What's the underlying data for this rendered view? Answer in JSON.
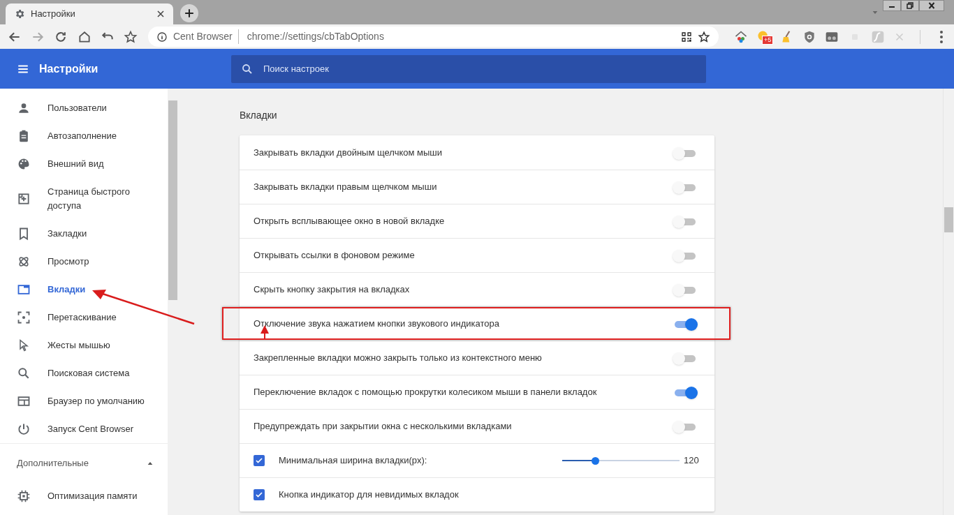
{
  "window": {
    "tab_title": "Настройки"
  },
  "address_bar": {
    "site_label": "Cent Browser",
    "url": "chrome://settings/cbTabOptions"
  },
  "extension_badge": "+5",
  "header": {
    "title": "Настройки",
    "search_placeholder": "Поиск настроек"
  },
  "sidebar": {
    "items": [
      {
        "label": "Пользователи",
        "selected": false
      },
      {
        "label": "Автозаполнение",
        "selected": false
      },
      {
        "label": "Внешний вид",
        "selected": false
      },
      {
        "label": "Страница быстрого доступа",
        "selected": false
      },
      {
        "label": "Закладки",
        "selected": false
      },
      {
        "label": "Просмотр",
        "selected": false
      },
      {
        "label": "Вкладки",
        "selected": true
      },
      {
        "label": "Перетаскивание",
        "selected": false
      },
      {
        "label": "Жесты мышью",
        "selected": false
      },
      {
        "label": "Поисковая система",
        "selected": false
      },
      {
        "label": "Браузер по умолчанию",
        "selected": false
      },
      {
        "label": "Запуск Cent Browser",
        "selected": false
      }
    ],
    "advanced": {
      "label": "Дополнительные",
      "expanded": true,
      "items": [
        {
          "label": "Оптимизация памяти",
          "selected": false
        }
      ]
    }
  },
  "section": {
    "title": "Вкладки",
    "rows": [
      {
        "kind": "toggle",
        "label": "Закрывать вкладки двойным щелчком мыши",
        "on": false
      },
      {
        "kind": "toggle",
        "label": "Закрывать вкладки правым щелчком мыши",
        "on": false
      },
      {
        "kind": "toggle",
        "label": "Открыть всплывающее окно в новой вкладке",
        "on": false
      },
      {
        "kind": "toggle",
        "label": "Открывать ссылки в фоновом режиме",
        "on": false
      },
      {
        "kind": "toggle",
        "label": "Скрыть кнопку закрытия на вкладках",
        "on": false
      },
      {
        "kind": "toggle",
        "label": "Отключение звука нажатием кнопки звукового индикатора",
        "on": true
      },
      {
        "kind": "toggle",
        "label": "Закрепленные вкладки можно закрыть только из контекстного меню",
        "on": false
      },
      {
        "kind": "toggle",
        "label": "Переключение вкладок с помощью прокрутки колесиком мыши в панели вкладок",
        "on": true
      },
      {
        "kind": "toggle",
        "label": "Предупреждать при закрытии окна с несколькими вкладками",
        "on": false
      },
      {
        "kind": "slider",
        "label": "Минимальная ширина вкладки(px):",
        "checked": true,
        "level": 0.28,
        "reading": "120"
      },
      {
        "kind": "checkbox",
        "label": "Кнопка индикатор для невидимых вкладок",
        "checked": true
      }
    ]
  }
}
